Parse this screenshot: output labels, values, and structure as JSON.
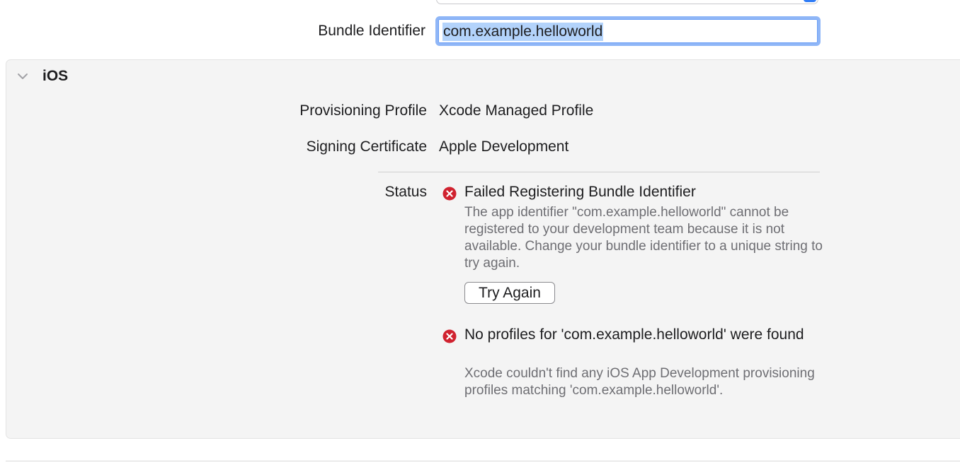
{
  "general": {
    "bundle_identifier_label": "Bundle Identifier",
    "bundle_identifier_value": "com.example.helloworld"
  },
  "ios_section": {
    "title": "iOS",
    "expanded": true,
    "provisioning_profile_label": "Provisioning Profile",
    "provisioning_profile_value": "Xcode Managed Profile",
    "signing_certificate_label": "Signing Certificate",
    "signing_certificate_value": "Apple Development",
    "status_label": "Status",
    "errors": [
      {
        "icon": "error-x-icon",
        "title": "Failed Registering Bundle Identifier",
        "description": "The app identifier \"com.example.helloworld\" cannot be registered to your development team because it is not available. Change your bundle identifier to a unique string to try again.",
        "action_label": "Try Again"
      },
      {
        "icon": "error-x-icon",
        "title": "No profiles for 'com.example.helloworld' were found",
        "description": "Xcode couldn't find any iOS App Development provisioning profiles matching 'com.example.helloworld'."
      }
    ]
  },
  "colors": {
    "error_red": "#d0222f",
    "focus_ring": "#8fb6f7",
    "selection": "#b3d3fb",
    "secondary_text": "#6e6e73",
    "panel_bg": "#f4f4f4"
  }
}
